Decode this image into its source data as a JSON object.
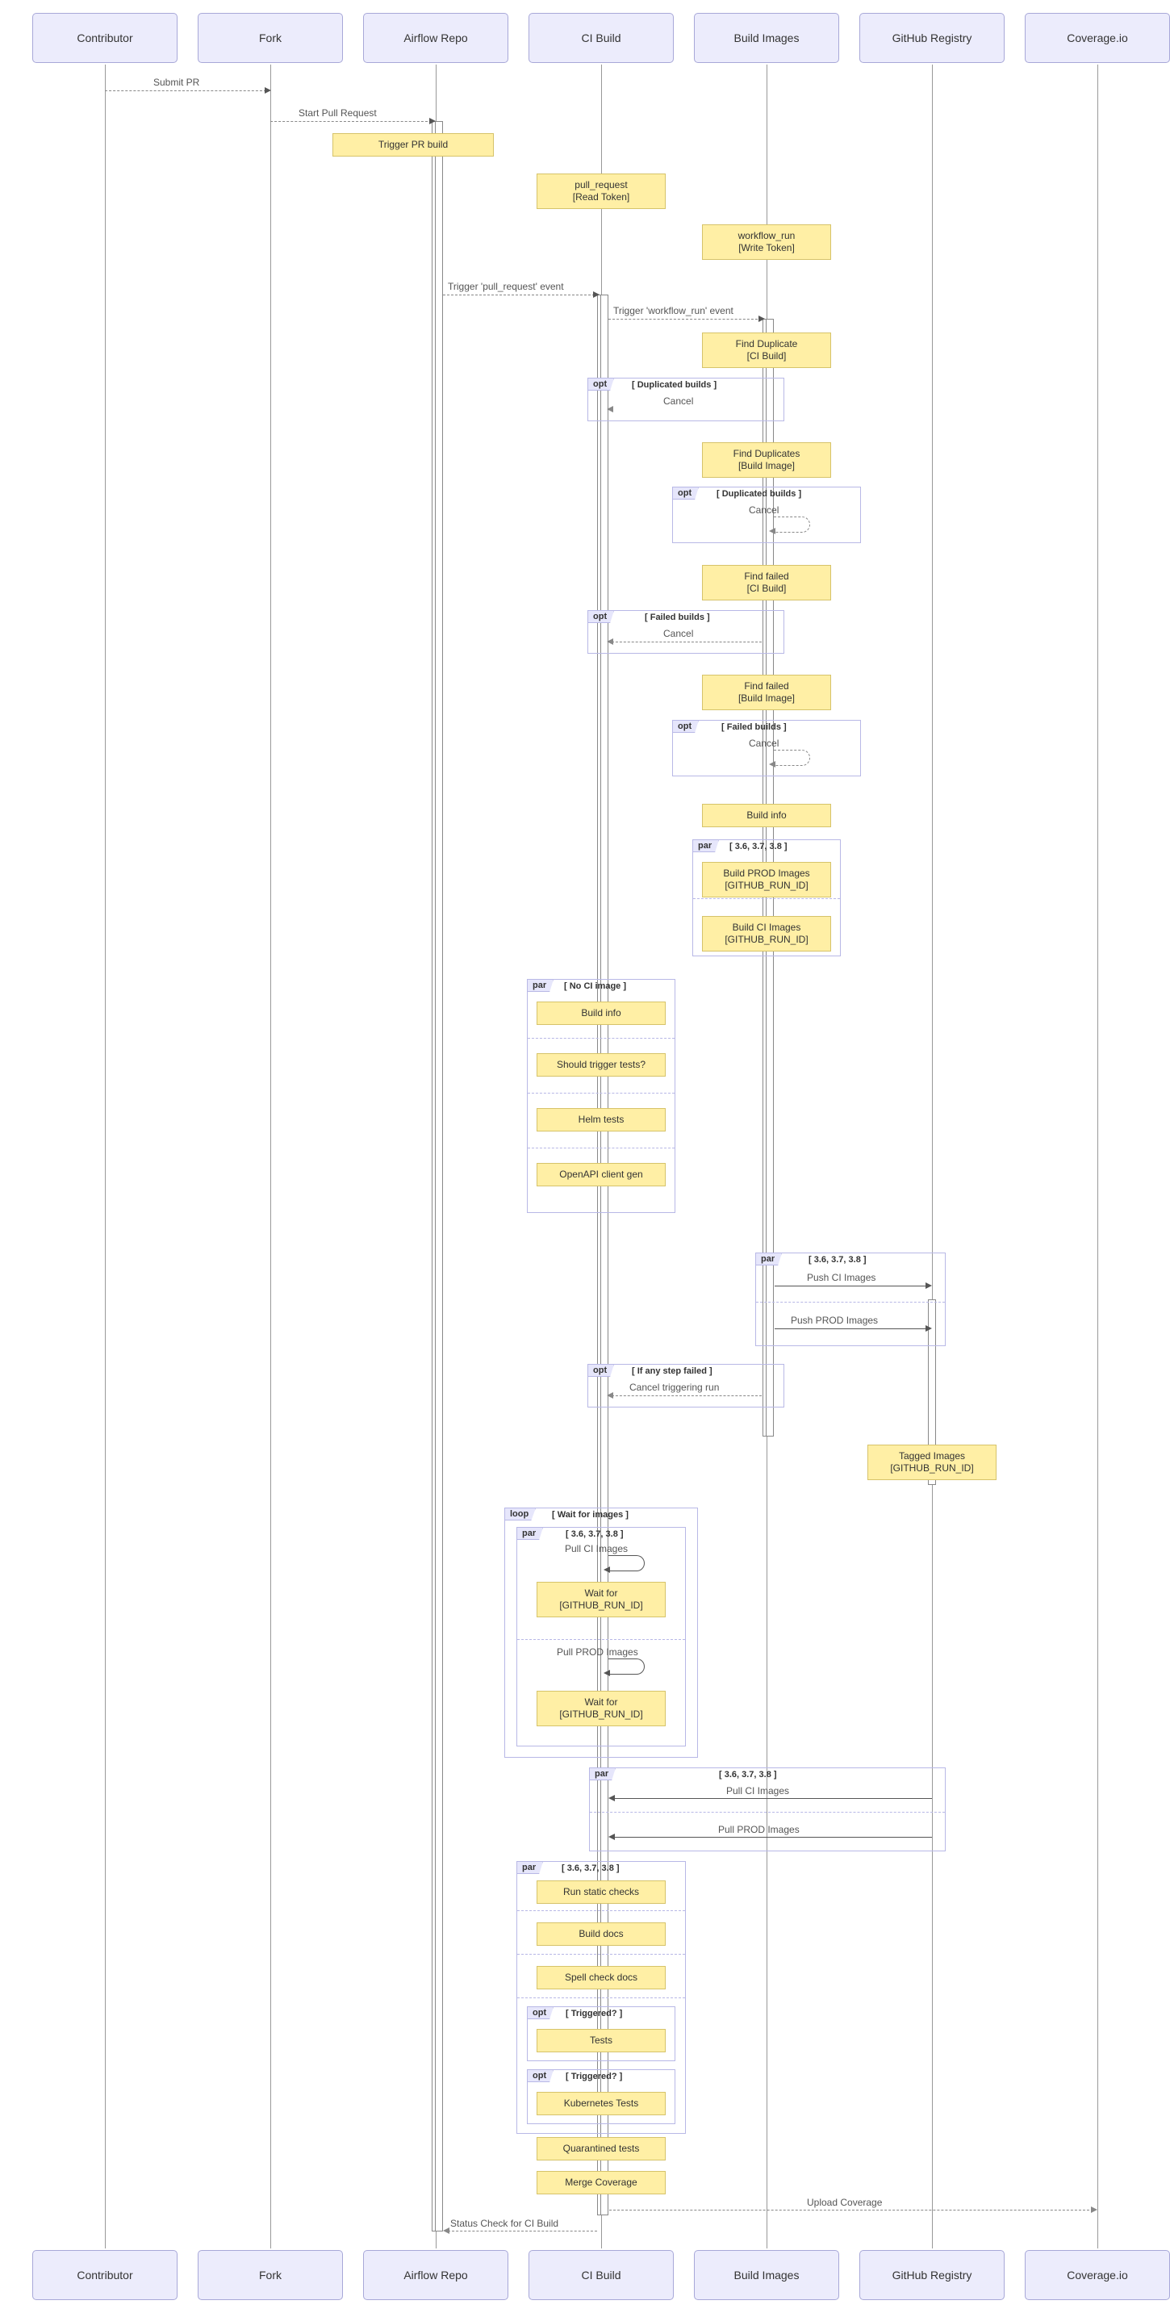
{
  "actors": {
    "contributor": "Contributor",
    "fork": "Fork",
    "airflow": "Airflow Repo",
    "ci": "CI Build",
    "build": "Build Images",
    "registry": "GitHub Registry",
    "coverage": "Coverage.io"
  },
  "messages": {
    "submit_pr": "Submit PR",
    "start_pr": "Start Pull Request",
    "trigger_pr": "Trigger PR build",
    "pull_req_note": "pull_request\n[Read Token]",
    "workflow_run_note": "workflow_run\n[Write Token]",
    "trig_pull_req": "Trigger 'pull_request' event",
    "trig_workflow": "Trigger 'workflow_run' event",
    "find_dup_ci": "Find Duplicate\n[CI Build]",
    "cancel": "Cancel",
    "find_dup_build": "Find Duplicates\n[Build Image]",
    "find_failed_ci": "Find failed\n[CI Build]",
    "find_failed_build": "Find failed\n[Build Image]",
    "build_info": "Build info",
    "build_prod": "Build PROD Images\n[GITHUB_RUN_ID]",
    "build_ci": "Build CI Images\n[GITHUB_RUN_ID]",
    "should_trigger": "Should trigger tests?",
    "helm": "Helm tests",
    "openapi": "OpenAPI client gen",
    "push_ci": "Push CI Images",
    "push_prod": "Push PROD Images",
    "cancel_trig": "Cancel triggering run",
    "tagged": "Tagged Images\n[GITHUB_RUN_ID]",
    "pull_ci": "Pull CI Images",
    "wait_for": "Wait for\n[GITHUB_RUN_ID]",
    "pull_prod": "Pull PROD Images",
    "run_static": "Run static checks",
    "build_docs": "Build docs",
    "spell": "Spell check docs",
    "tests": "Tests",
    "kube": "Kubernetes Tests",
    "quarantined": "Quarantined tests",
    "merge_cov": "Merge Coverage",
    "upload_cov": "Upload Coverage",
    "status_check": "Status Check for CI Build"
  },
  "fragments": {
    "opt": "opt",
    "par": "par",
    "loop": "loop",
    "dup_builds": "[ Duplicated builds ]",
    "failed_builds": "[ Failed builds ]",
    "versions": "[ 3.6, 3.7, 3.8 ]",
    "no_ci": "[ No CI image ]",
    "any_failed": "[ If any step failed ]",
    "wait_images": "[ Wait for images ]",
    "triggered": "[ Triggered? ]"
  },
  "chart_data": {
    "type": "sequence_diagram",
    "participants": [
      "Contributor",
      "Fork",
      "Airflow Repo",
      "CI Build",
      "Build Images",
      "GitHub Registry",
      "Coverage.io"
    ],
    "interactions": [
      {
        "from": "Contributor",
        "to": "Fork",
        "label": "Submit PR",
        "style": "dashed"
      },
      {
        "from": "Fork",
        "to": "Airflow Repo",
        "label": "Start Pull Request",
        "style": "dashed"
      },
      {
        "actor": "Airflow Repo",
        "note": "Trigger PR build"
      },
      {
        "actor": "CI Build",
        "note": "pull_request [Read Token]"
      },
      {
        "actor": "Build Images",
        "note": "workflow_run [Write Token]"
      },
      {
        "from": "Airflow Repo",
        "to": "CI Build",
        "label": "Trigger 'pull_request' event",
        "style": "dashed"
      },
      {
        "from": "CI Build",
        "to": "Build Images",
        "label": "Trigger 'workflow_run' event",
        "style": "dashed"
      },
      {
        "actor": "Build Images",
        "note": "Find Duplicate [CI Build]"
      },
      {
        "fragment": "opt",
        "guard": "[ Duplicated builds ]",
        "body": [
          {
            "from": "Build Images",
            "to": "CI Build",
            "label": "Cancel",
            "style": "dashed"
          }
        ]
      },
      {
        "actor": "Build Images",
        "note": "Find Duplicates [Build Image]"
      },
      {
        "fragment": "opt",
        "guard": "[ Duplicated builds ]",
        "body": [
          {
            "from": "Build Images",
            "to": "Build Images",
            "label": "Cancel",
            "style": "dashed-self"
          }
        ]
      },
      {
        "actor": "Build Images",
        "note": "Find failed [CI Build]"
      },
      {
        "fragment": "opt",
        "guard": "[ Failed builds ]",
        "body": [
          {
            "from": "Build Images",
            "to": "CI Build",
            "label": "Cancel",
            "style": "dashed"
          }
        ]
      },
      {
        "actor": "Build Images",
        "note": "Find failed [Build Image]"
      },
      {
        "fragment": "opt",
        "guard": "[ Failed builds ]",
        "body": [
          {
            "from": "Build Images",
            "to": "Build Images",
            "label": "Cancel",
            "style": "dashed-self"
          }
        ]
      },
      {
        "actor": "Build Images",
        "note": "Build info"
      },
      {
        "fragment": "par",
        "guard": "[ 3.6, 3.7, 3.8 ]",
        "body": [
          {
            "actor": "Build Images",
            "note": "Build PROD Images [GITHUB_RUN_ID]"
          },
          {
            "actor": "Build Images",
            "note": "Build CI Images [GITHUB_RUN_ID]"
          }
        ]
      },
      {
        "fragment": "par",
        "guard": "[ No CI image ]",
        "body": [
          {
            "actor": "CI Build",
            "note": "Build info"
          },
          {
            "actor": "CI Build",
            "note": "Should trigger tests?"
          },
          {
            "actor": "CI Build",
            "note": "Helm tests"
          },
          {
            "actor": "CI Build",
            "note": "OpenAPI client gen"
          }
        ]
      },
      {
        "fragment": "par",
        "guard": "[ 3.6, 3.7, 3.8 ]",
        "body": [
          {
            "from": "Build Images",
            "to": "GitHub Registry",
            "label": "Push CI Images",
            "style": "solid"
          },
          {
            "from": "Build Images",
            "to": "GitHub Registry",
            "label": "Push PROD Images",
            "style": "solid"
          }
        ]
      },
      {
        "fragment": "opt",
        "guard": "[ If any step failed ]",
        "body": [
          {
            "from": "Build Images",
            "to": "CI Build",
            "label": "Cancel triggering run",
            "style": "dashed"
          }
        ]
      },
      {
        "actor": "GitHub Registry",
        "note": "Tagged Images [GITHUB_RUN_ID]"
      },
      {
        "fragment": "loop",
        "guard": "[ Wait for images ]",
        "body": [
          {
            "fragment": "par",
            "guard": "[ 3.6, 3.7, 3.8 ]",
            "body": [
              {
                "from": "CI Build",
                "to": "CI Build",
                "label": "Pull CI Images",
                "style": "solid-self"
              },
              {
                "actor": "CI Build",
                "note": "Wait for [GITHUB_RUN_ID]"
              },
              {
                "from": "CI Build",
                "to": "CI Build",
                "label": "Pull PROD Images",
                "style": "solid-self"
              },
              {
                "actor": "CI Build",
                "note": "Wait for [GITHUB_RUN_ID]"
              }
            ]
          }
        ]
      },
      {
        "fragment": "par",
        "guard": "[ 3.6, 3.7, 3.8 ]",
        "body": [
          {
            "from": "GitHub Registry",
            "to": "CI Build",
            "label": "Pull CI Images",
            "style": "solid"
          },
          {
            "from": "GitHub Registry",
            "to": "CI Build",
            "label": "Pull PROD Images",
            "style": "solid"
          }
        ]
      },
      {
        "fragment": "par",
        "guard": "[ 3.6, 3.7, 3.8 ]",
        "body": [
          {
            "actor": "CI Build",
            "note": "Run static checks"
          },
          {
            "actor": "CI Build",
            "note": "Build docs"
          },
          {
            "actor": "CI Build",
            "note": "Spell check docs"
          },
          {
            "fragment": "opt",
            "guard": "[ Triggered? ]",
            "body": [
              {
                "actor": "CI Build",
                "note": "Tests"
              }
            ]
          },
          {
            "fragment": "opt",
            "guard": "[ Triggered? ]",
            "body": [
              {
                "actor": "CI Build",
                "note": "Kubernetes Tests"
              }
            ]
          }
        ]
      },
      {
        "actor": "CI Build",
        "note": "Quarantined tests"
      },
      {
        "actor": "CI Build",
        "note": "Merge Coverage"
      },
      {
        "from": "CI Build",
        "to": "Coverage.io",
        "label": "Upload Coverage",
        "style": "dashed"
      },
      {
        "from": "CI Build",
        "to": "Airflow Repo",
        "label": "Status Check for CI Build",
        "style": "dashed"
      }
    ]
  }
}
